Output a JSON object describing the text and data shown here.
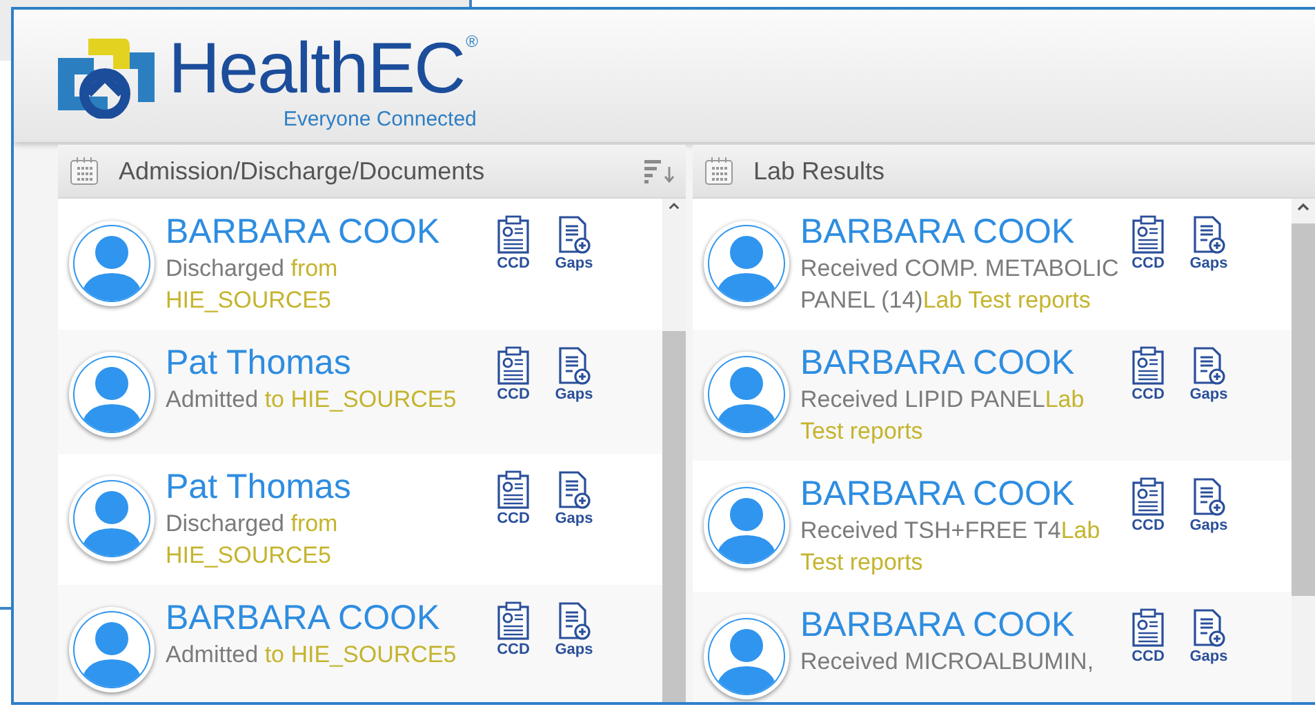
{
  "header": {
    "brand": "HealthEC",
    "brand_mark": "®",
    "tagline": "Everyone Connected"
  },
  "panels": [
    {
      "title": "Admission/Discharge/Documents",
      "sortable": true,
      "rows": [
        {
          "name": "BARBARA COOK",
          "text": "Discharged",
          "detail": " from HIE_SOURCE5",
          "actions": [
            {
              "kind": "ccd",
              "label": "CCD"
            },
            {
              "kind": "gaps",
              "label": "Gaps"
            }
          ]
        },
        {
          "name": "Pat Thomas",
          "text": "Admitted",
          "detail": " to HIE_SOURCE5",
          "actions": [
            {
              "kind": "ccd",
              "label": "CCD"
            },
            {
              "kind": "gaps",
              "label": "Gaps"
            }
          ]
        },
        {
          "name": "Pat Thomas",
          "text": "Discharged",
          "detail": " from HIE_SOURCE5",
          "actions": [
            {
              "kind": "ccd",
              "label": "CCD"
            },
            {
              "kind": "gaps",
              "label": "Gaps"
            }
          ]
        },
        {
          "name": "BARBARA COOK",
          "text": "Admitted",
          "detail": " to HIE_SOURCE5",
          "actions": [
            {
              "kind": "ccd",
              "label": "CCD"
            },
            {
              "kind": "gaps",
              "label": "Gaps"
            }
          ]
        }
      ]
    },
    {
      "title": "Lab Results",
      "rows": [
        {
          "name": "BARBARA COOK",
          "text": "Received COMP. METABOLIC PANEL (14)",
          "detail": "Lab Test reports",
          "actions": [
            {
              "kind": "ccd",
              "label": "CCD"
            },
            {
              "kind": "gaps",
              "label": "Gaps"
            }
          ]
        },
        {
          "name": "BARBARA COOK",
          "text": "Received LIPID PANEL",
          "detail": "Lab Test reports",
          "actions": [
            {
              "kind": "ccd",
              "label": "CCD"
            },
            {
              "kind": "gaps",
              "label": "Gaps"
            }
          ]
        },
        {
          "name": "BARBARA COOK",
          "text": "Received TSH+FREE T4",
          "detail": "Lab Test reports",
          "actions": [
            {
              "kind": "ccd",
              "label": "CCD"
            },
            {
              "kind": "gaps",
              "label": "Gaps"
            }
          ]
        },
        {
          "name": "BARBARA COOK",
          "text": "Received MICROALBUMIN,",
          "actions": [
            {
              "kind": "ccd",
              "label": "CCD"
            },
            {
              "kind": "gaps",
              "label": "Gaps"
            }
          ]
        }
      ]
    }
  ]
}
